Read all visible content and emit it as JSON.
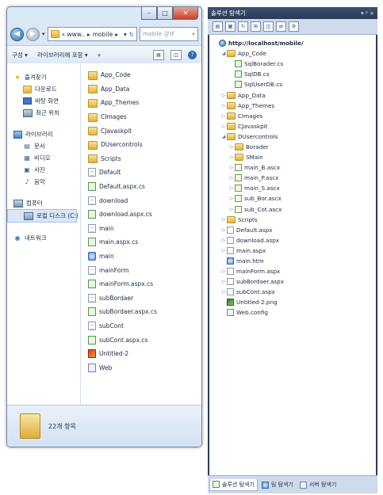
{
  "explorer": {
    "address": {
      "crumbs": [
        "« www..",
        "mobile"
      ],
      "separator": "▸"
    },
    "search_placeholder": "mobile 검색",
    "toolbar": {
      "organize": "구성 ▾",
      "include_library": "라이브러리에 포함 ▾",
      "more": "»"
    },
    "nav": {
      "favorites": {
        "label": "즐겨찾기",
        "items": [
          "다운로드",
          "바탕 화면",
          "최근 위치"
        ]
      },
      "libraries": {
        "label": "라이브러리",
        "items": [
          "문서",
          "비디오",
          "사진",
          "음악"
        ]
      },
      "computer": {
        "label": "컴퓨터",
        "items": [
          "로컬 디스크 (C:)"
        ]
      },
      "network": {
        "label": "네트워크"
      }
    },
    "files": [
      {
        "name": "App_Code",
        "type": "folder"
      },
      {
        "name": "App_Data",
        "type": "folder"
      },
      {
        "name": "App_Themes",
        "type": "folder"
      },
      {
        "name": "CImages",
        "type": "folder"
      },
      {
        "name": "CJavaskpit",
        "type": "folder"
      },
      {
        "name": "DUsercontrols",
        "type": "folder"
      },
      {
        "name": "Scripts",
        "type": "folder"
      },
      {
        "name": "Default",
        "type": "page"
      },
      {
        "name": "Default.aspx.cs",
        "type": "cs"
      },
      {
        "name": "download",
        "type": "page"
      },
      {
        "name": "download.aspx.cs",
        "type": "cs"
      },
      {
        "name": "main",
        "type": "page"
      },
      {
        "name": "main.aspx.cs",
        "type": "cs"
      },
      {
        "name": "main",
        "type": "web"
      },
      {
        "name": "mainForm",
        "type": "page"
      },
      {
        "name": "mainForm.aspx.cs",
        "type": "cs"
      },
      {
        "name": "subBordaer",
        "type": "page"
      },
      {
        "name": "subBordaer.aspx.cs",
        "type": "cs"
      },
      {
        "name": "subCont",
        "type": "page"
      },
      {
        "name": "subCont.aspx.cs",
        "type": "cs"
      },
      {
        "name": "Untitled-2",
        "type": "png"
      },
      {
        "name": "Web",
        "type": "cfg"
      }
    ],
    "status": {
      "count": "22개 항목"
    }
  },
  "solution": {
    "title": "솔루션 탐색기",
    "title_controls": "▾ ᵖ ×",
    "tree": [
      {
        "label": "http://localhost/mobile/",
        "icon": "globe",
        "depth": 0,
        "twisty": "",
        "bold": true
      },
      {
        "label": "App_Code",
        "icon": "folder",
        "depth": 1,
        "twisty": "◢"
      },
      {
        "label": "SqlBorader.cs",
        "icon": "cs",
        "depth": 2,
        "twisty": ""
      },
      {
        "label": "SqlDB.cs",
        "icon": "cs",
        "depth": 2,
        "twisty": ""
      },
      {
        "label": "SqlUserDB.cs",
        "icon": "cs",
        "depth": 2,
        "twisty": ""
      },
      {
        "label": "App_Data",
        "icon": "folder",
        "depth": 1,
        "twisty": "▷"
      },
      {
        "label": "App_Themes",
        "icon": "folder",
        "depth": 1,
        "twisty": "▷"
      },
      {
        "label": "CImages",
        "icon": "folder",
        "depth": 1,
        "twisty": "▷"
      },
      {
        "label": "CJavaskpit",
        "icon": "folder",
        "depth": 1,
        "twisty": "▷"
      },
      {
        "label": "DUsercontrols",
        "icon": "folder",
        "depth": 1,
        "twisty": "◢"
      },
      {
        "label": "Borader",
        "icon": "folder",
        "depth": 2,
        "twisty": "▷"
      },
      {
        "label": "SMain",
        "icon": "folder",
        "depth": 2,
        "twisty": "▷"
      },
      {
        "label": "main_B.ascx",
        "icon": "ascx",
        "depth": 2,
        "twisty": "▷"
      },
      {
        "label": "main_P.ascx",
        "icon": "ascx",
        "depth": 2,
        "twisty": "▷"
      },
      {
        "label": "main_S.ascx",
        "icon": "ascx",
        "depth": 2,
        "twisty": "▷"
      },
      {
        "label": "sub_Bor.ascx",
        "icon": "ascx",
        "depth": 2,
        "twisty": "▷"
      },
      {
        "label": "sub_Cot.ascx",
        "icon": "ascx",
        "depth": 2,
        "twisty": "▷"
      },
      {
        "label": "Scripts",
        "icon": "folder",
        "depth": 1,
        "twisty": "▷"
      },
      {
        "label": "Default.aspx",
        "icon": "page",
        "depth": 1,
        "twisty": "▷"
      },
      {
        "label": "download.aspx",
        "icon": "page",
        "depth": 1,
        "twisty": "▷"
      },
      {
        "label": "main.aspx",
        "icon": "page",
        "depth": 1,
        "twisty": "▷"
      },
      {
        "label": "main.htm",
        "icon": "web",
        "depth": 1,
        "twisty": ""
      },
      {
        "label": "mainForm.aspx",
        "icon": "page",
        "depth": 1,
        "twisty": "▷"
      },
      {
        "label": "subBordaer.aspx",
        "icon": "page",
        "depth": 1,
        "twisty": "▷"
      },
      {
        "label": "subCont.aspx",
        "icon": "page",
        "depth": 1,
        "twisty": "▷"
      },
      {
        "label": "Untitled-2.png",
        "icon": "png",
        "depth": 1,
        "twisty": ""
      },
      {
        "label": "Web.config",
        "icon": "cfg",
        "depth": 1,
        "twisty": ""
      }
    ],
    "tabs": [
      "솔루션 탐색기",
      "팀 탐색기",
      "서버 탐색기"
    ]
  }
}
